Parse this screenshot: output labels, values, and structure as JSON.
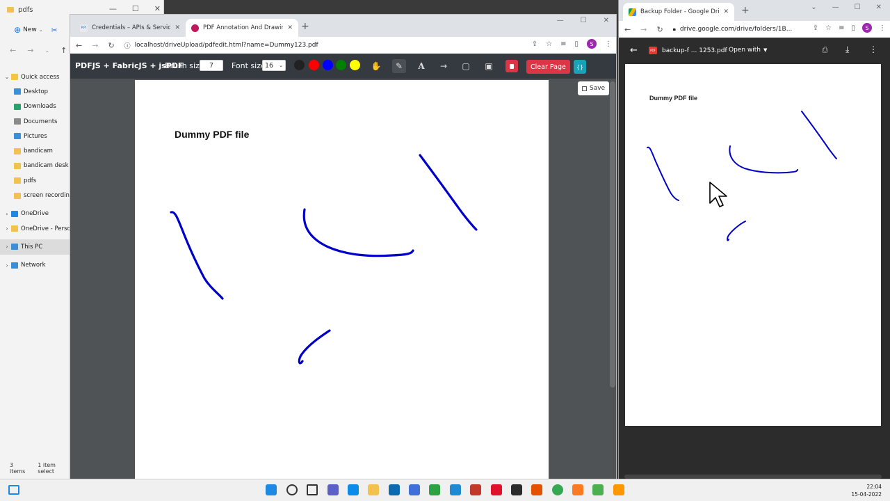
{
  "explorer": {
    "title": "pdfs",
    "new_label": "New",
    "nav_items": [
      {
        "label": "Quick access",
        "icon": "star-icon",
        "color": "#f6c344"
      },
      {
        "label": "Desktop",
        "icon": "desktop-icon",
        "color": "#3a8fd6"
      },
      {
        "label": "Downloads",
        "icon": "download-icon",
        "color": "#2e9e6a"
      },
      {
        "label": "Documents",
        "icon": "document-icon",
        "color": "#8a8a8a"
      },
      {
        "label": "Pictures",
        "icon": "picture-icon",
        "color": "#3a8fd6"
      },
      {
        "label": "bandicam",
        "icon": "folder-icon",
        "color": "#f2c14e"
      },
      {
        "label": "bandicam desk",
        "icon": "folder-icon",
        "color": "#f2c14e"
      },
      {
        "label": "pdfs",
        "icon": "folder-icon",
        "color": "#f2c14e"
      },
      {
        "label": "screen recordin",
        "icon": "folder-icon",
        "color": "#f2c14e"
      },
      {
        "label": "OneDrive",
        "icon": "cloud-icon",
        "color": "#1e88e5"
      },
      {
        "label": "OneDrive - Perso",
        "icon": "folder-icon",
        "color": "#f2c14e"
      },
      {
        "label": "This PC",
        "icon": "computer-icon",
        "color": "#3a8fd6"
      },
      {
        "label": "Network",
        "icon": "network-icon",
        "color": "#3a8fd6"
      }
    ],
    "status_items": "3 items",
    "status_selected": "1 item select"
  },
  "chrome_main": {
    "tabs": [
      {
        "title": "Credentials – APIs & Services – p",
        "favicon_color": "#5f6368",
        "favicon_text": "RPI"
      },
      {
        "title": "PDF Annotation And Drawing M",
        "favicon_color": "#c2185b"
      }
    ],
    "url": "localhost/driveUpload/pdfedit.html?name=Dummy123.pdf",
    "avatar": "S"
  },
  "app": {
    "brand": "PDFJS + FabricJS + jsPDF",
    "brush_label": "Brush size",
    "brush_value": "7",
    "font_label": "Font size",
    "font_value": "16",
    "colors": [
      "#212121",
      "#ff0000",
      "#0000ff",
      "#008000",
      "#ffff00"
    ],
    "clear_label": "Clear Page",
    "json_label": "{}",
    "save_label": "Save"
  },
  "pdf": {
    "heading": "Dummy PDF file",
    "stroke_color": "#0000c8"
  },
  "chrome_drive": {
    "tab_title": "Backup Folder - Google Drive",
    "url": "drive.google.com/drive/folders/1B...",
    "avatar": "S",
    "file_name": "backup-f ... 1253.pdf",
    "open_with": "Open with",
    "pdf_badge": "PDF",
    "heading": "Dummy PDF file"
  },
  "taskbar": {
    "time": "22:04",
    "date": "15-04-2022",
    "apps": [
      {
        "name": "windows-start",
        "color": "#1e88e5"
      },
      {
        "name": "search",
        "color": "#333333"
      },
      {
        "name": "task-view",
        "color": "#333333"
      },
      {
        "name": "teams",
        "color": "#5b5fc7"
      },
      {
        "name": "edge",
        "color": "#0c8ce9"
      },
      {
        "name": "file-explorer",
        "color": "#f2c14e"
      },
      {
        "name": "mail",
        "color": "#0b6ab0"
      },
      {
        "name": "affinity",
        "color": "#3f6fd8"
      },
      {
        "name": "xbox",
        "color": "#2ca243"
      },
      {
        "name": "vscode",
        "color": "#1f8ad2"
      },
      {
        "name": "toolbox",
        "color": "#c0392b"
      },
      {
        "name": "opera",
        "color": "#e0112b"
      },
      {
        "name": "obs",
        "color": "#2b2b2b"
      },
      {
        "name": "snipping",
        "color": "#e65100"
      },
      {
        "name": "chrome",
        "color": "#34a853"
      },
      {
        "name": "xampp",
        "color": "#fb7a24"
      },
      {
        "name": "notepad",
        "color": "#4caf50"
      },
      {
        "name": "sublime",
        "color": "#ff9800"
      }
    ]
  }
}
